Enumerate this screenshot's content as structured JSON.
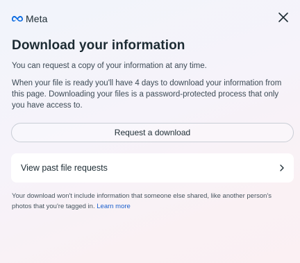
{
  "header": {
    "brand": "Meta",
    "close_icon": "close-icon",
    "logo_icon": "meta-infinity-logo"
  },
  "main": {
    "title": "Download your information",
    "description_1": "You can request a copy of your information at any time.",
    "description_2": "When your file is ready you'll have 4 days to download your information from this page. Downloading your files is a password-protected process that only you have access to.",
    "request_button_label": "Request a download",
    "past_requests_label": "View past file requests",
    "footnote": "Your download won't include information that someone else shared, like another person's photos that you're tagged in.",
    "learn_more_label": "Learn more"
  },
  "colors": {
    "link": "#1b5fcc",
    "text_primary": "#1c2b33",
    "meta_blue": "#0668e1"
  }
}
